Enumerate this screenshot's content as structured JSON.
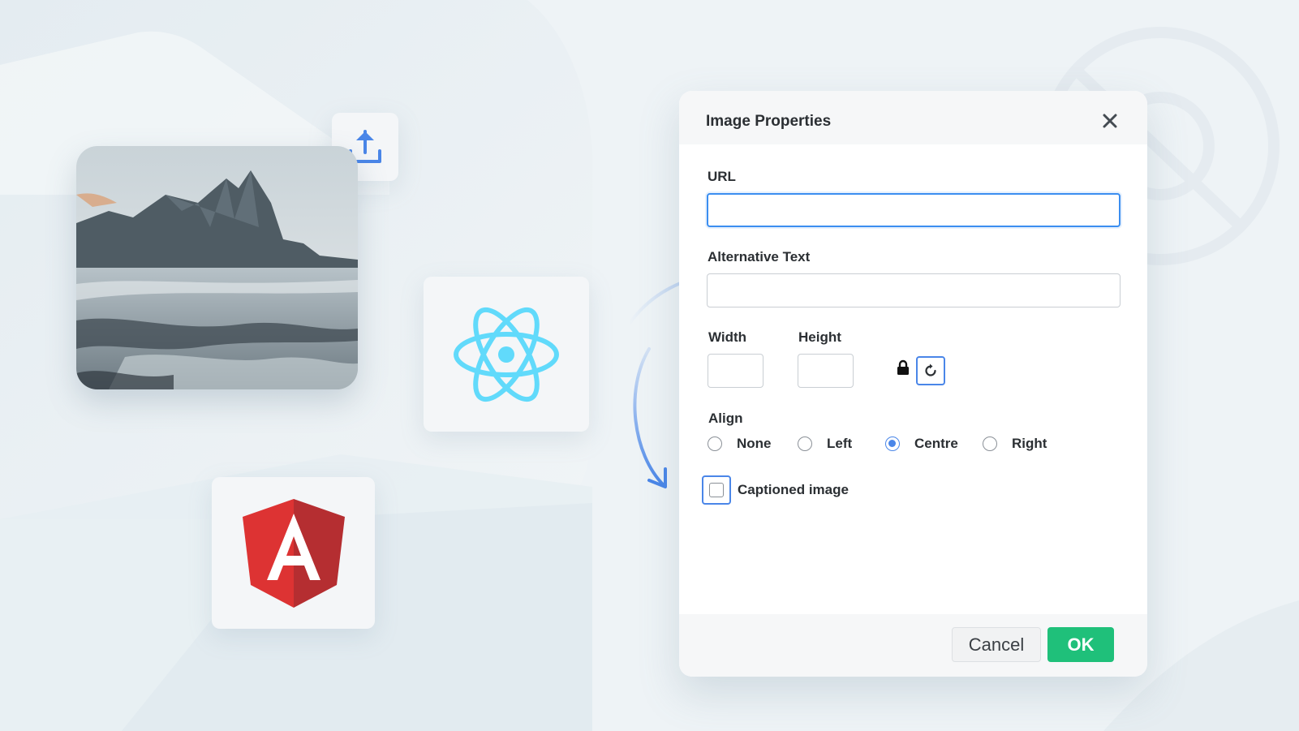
{
  "dialog": {
    "title": "Image Properties",
    "url_label": "URL",
    "url_value": "",
    "alt_label": "Alternative Text",
    "alt_value": "",
    "width_label": "Width",
    "width_value": "",
    "height_label": "Height",
    "height_value": "",
    "align_label": "Align",
    "align_options": [
      {
        "label": "None",
        "checked": false
      },
      {
        "label": "Left",
        "checked": false
      },
      {
        "label": "Centre",
        "checked": true
      },
      {
        "label": "Right",
        "checked": false
      }
    ],
    "caption_label": "Captioned image",
    "caption_checked": false,
    "cancel_label": "Cancel",
    "ok_label": "OK"
  },
  "icons": {
    "close": "close-icon",
    "lock": "lock-icon",
    "reset": "reset-icon",
    "upload": "upload-icon",
    "react": "react-logo-icon",
    "angular": "angular-logo-icon"
  },
  "colors": {
    "accent": "#4a86e8",
    "focus": "#3b8ef0",
    "ok": "#1fc07a",
    "react": "#61dafb",
    "angular_red": "#dd3333",
    "angular_dark": "#b52e31",
    "background": "#eef3f6"
  }
}
